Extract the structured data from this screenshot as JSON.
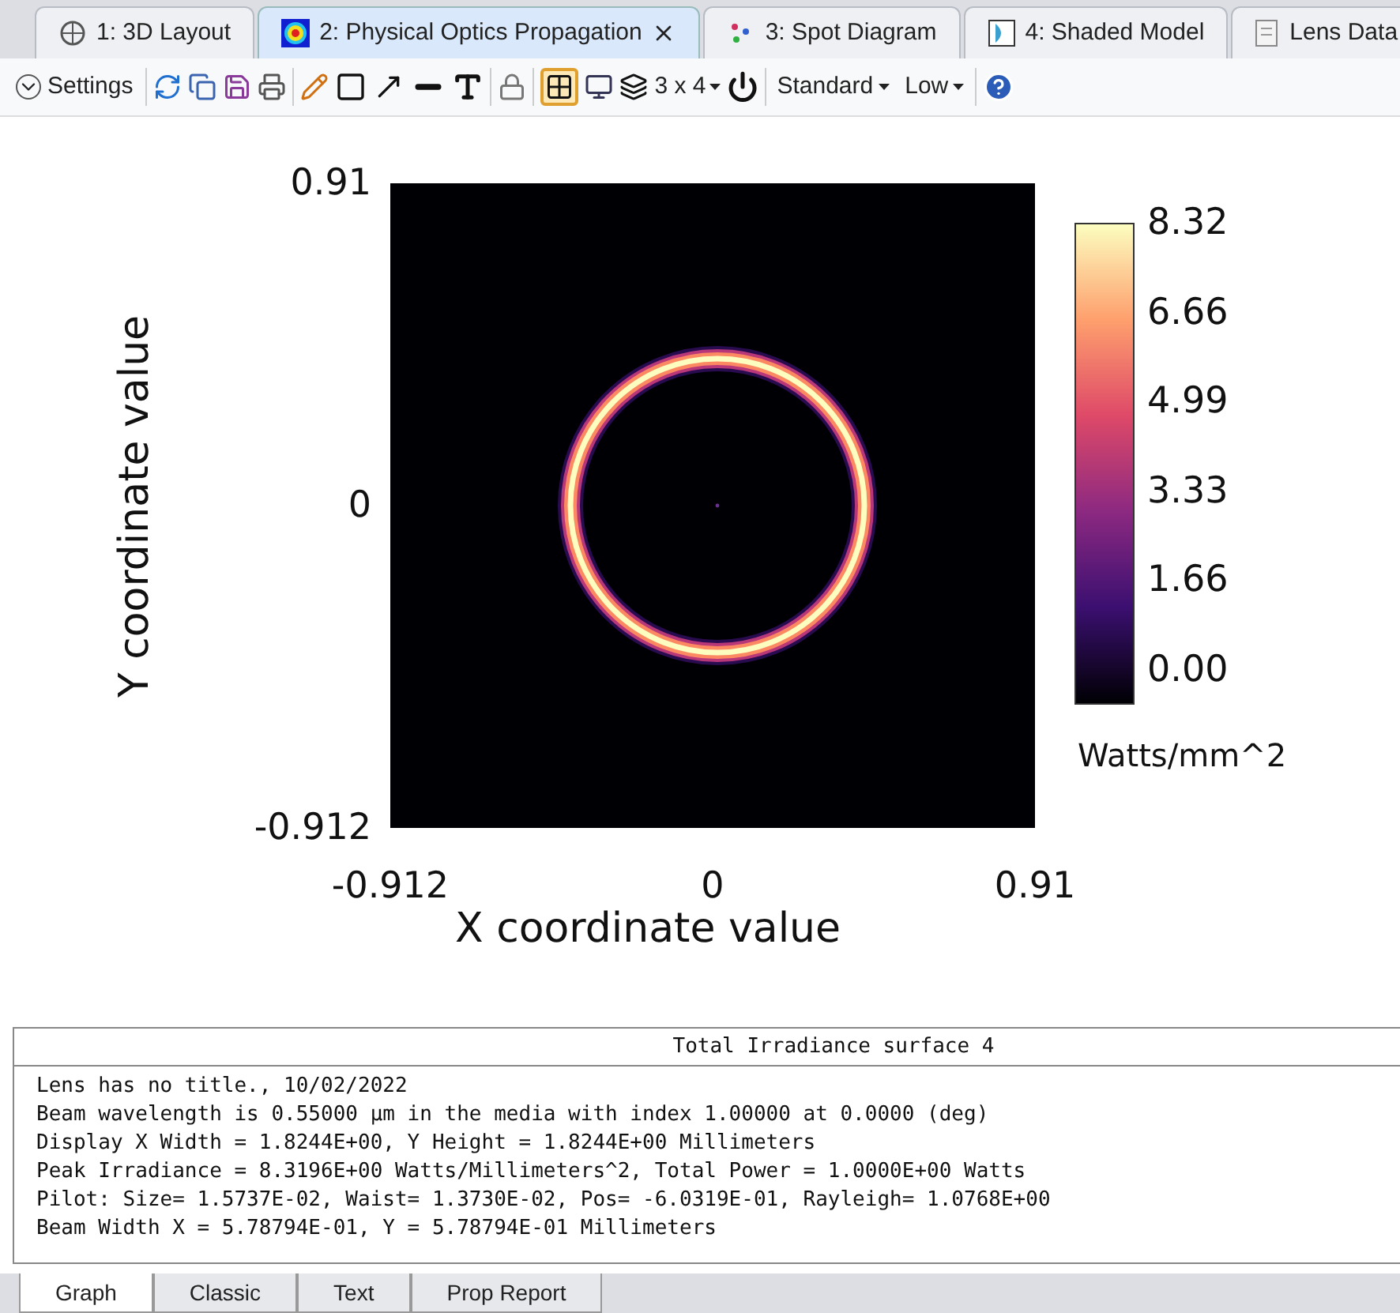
{
  "tabs": [
    {
      "label": "1: 3D Layout",
      "selected": false,
      "kind": "lens"
    },
    {
      "label": "2: Physical Optics Propagation",
      "selected": true,
      "kind": "map"
    },
    {
      "label": "3: Spot Diagram",
      "selected": false,
      "kind": "spots"
    },
    {
      "label": "4: Shaded Model",
      "selected": false,
      "kind": "shaded"
    },
    {
      "label": "Lens Data",
      "selected": false,
      "kind": "sheet"
    }
  ],
  "toolbar": {
    "settings_label": "Settings",
    "grid_toggle": {
      "selected": true
    },
    "layout_label": "3 x 4",
    "dropdowns": [
      "Standard",
      "Low"
    ]
  },
  "plot": {
    "y_axis_label": "Y coordinate value",
    "x_axis_label": "X coordinate value",
    "y_ticks": [
      "0.91",
      "0",
      "-0.912"
    ],
    "x_ticks": [
      "-0.912",
      "0",
      "0.91"
    ],
    "colorbar_ticks": [
      "8.32",
      "6.66",
      "4.99",
      "3.33",
      "1.66",
      "0.00"
    ],
    "colorbar_units": "Watts/mm^2"
  },
  "text_panel": {
    "title": "Total Irradiance surface 4",
    "lines": [
      "Lens has no title., 10/02/2022",
      "Beam wavelength is 0.55000 µm in the media with index 1.00000 at 0.0000 (deg)",
      "Display X Width = 1.8244E+00, Y Height = 1.8244E+00 Millimeters",
      "Peak Irradiance = 8.3196E+00 Watts/Millimeters^2, Total Power = 1.0000E+00 Watts",
      "Pilot: Size= 1.5737E-02, Waist= 1.3730E-02, Pos= -6.0319E-01, Rayleigh= 1.0768E+00",
      "Beam Width X = 5.78794E-01, Y = 5.78794E-01 Millimeters"
    ]
  },
  "bottom_tabs": [
    {
      "label": "Graph",
      "selected": true
    },
    {
      "label": "Classic",
      "selected": false
    },
    {
      "label": "Text",
      "selected": false
    },
    {
      "label": "Prop Report",
      "selected": false
    }
  ]
}
